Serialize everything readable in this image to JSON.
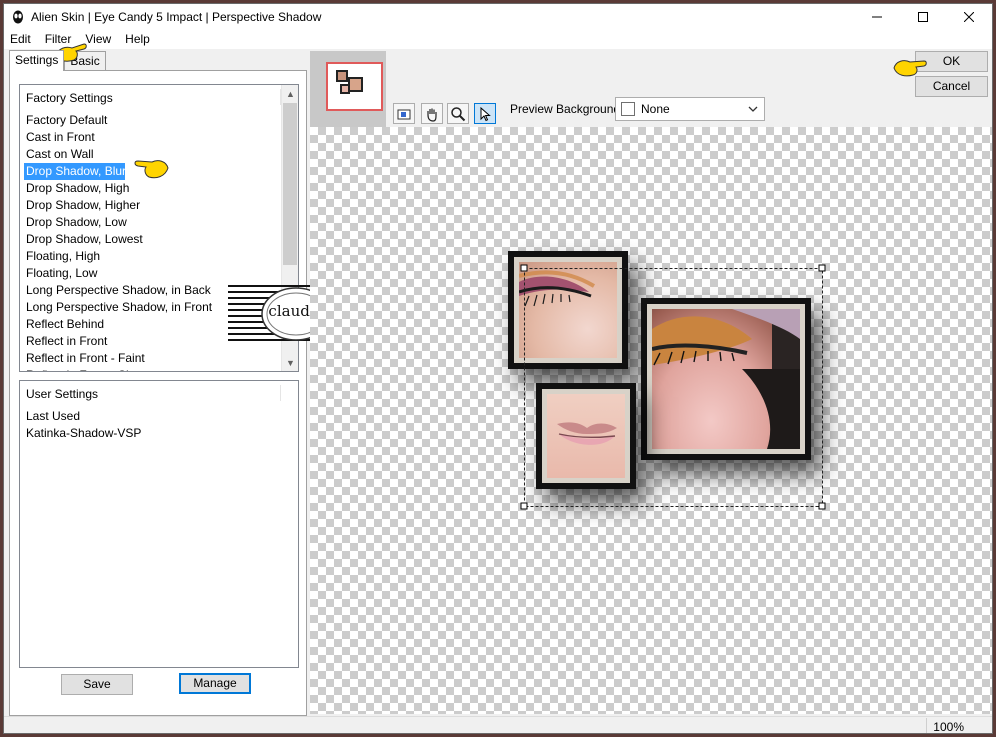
{
  "window": {
    "title": "Alien Skin | Eye Candy 5 Impact | Perspective Shadow"
  },
  "menu": [
    "Edit",
    "Filter",
    "View",
    "Help"
  ],
  "tabs": [
    "Settings",
    "Basic"
  ],
  "factory": {
    "header": "Factory Settings",
    "items": [
      "Factory Default",
      "Cast in Front",
      "Cast on Wall",
      "Drop Shadow, Blurry",
      "Drop Shadow, High",
      "Drop Shadow, Higher",
      "Drop Shadow, Low",
      "Drop Shadow, Lowest",
      "Floating, High",
      "Floating, Low",
      "Long Perspective Shadow, in Back",
      "Long Perspective Shadow, in Front",
      "Reflect Behind",
      "Reflect in Front",
      "Reflect in Front - Faint",
      "Reflect in Front - Sharp"
    ],
    "selected": "Drop Shadow, Blurry"
  },
  "user": {
    "header": "User Settings",
    "items": [
      "Last Used",
      "Katinka-Shadow-VSP"
    ]
  },
  "buttons": {
    "save": "Save",
    "manage": "Manage",
    "ok": "OK",
    "cancel": "Cancel"
  },
  "preview": {
    "label": "Preview Background:",
    "background": "None"
  },
  "watermark": {
    "text": "claudia"
  },
  "status": {
    "zoom": "100%"
  }
}
